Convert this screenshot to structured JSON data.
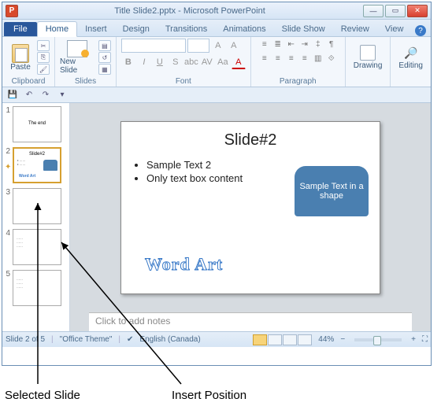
{
  "title": "Title Slide2.pptx - Microsoft PowerPoint",
  "app_icon_letter": "P",
  "tabs": {
    "file": "File",
    "home": "Home",
    "insert": "Insert",
    "design": "Design",
    "transitions": "Transitions",
    "animations": "Animations",
    "slideshow": "Slide Show",
    "review": "Review",
    "view": "View"
  },
  "ribbon": {
    "paste": "Paste",
    "clipboard": "Clipboard",
    "newslide": "New Slide",
    "slides": "Slides",
    "font": "Font",
    "paragraph": "Paragraph",
    "drawing": "Drawing",
    "editing": "Editing"
  },
  "thumbs": [
    "1",
    "2",
    "3",
    "4",
    "5"
  ],
  "thumb1_text": "The end",
  "thumb2_line1": "Slide#2",
  "thumb2_shape": "",
  "thumb2_wa": "Word Art",
  "slide": {
    "title": "Slide#2",
    "bullet1": "Sample Text 2",
    "bullet2": "Only text box content",
    "shape_text": "Sample Text in a shape",
    "wordart": "Word Art"
  },
  "notes_placeholder": "Click to add notes",
  "status": {
    "slide": "Slide 2 of 5",
    "theme": "\"Office Theme\"",
    "lang": "English (Canada)",
    "zoom": "44%"
  },
  "annotations": {
    "selected": "Selected Slide",
    "insert": "Insert Position"
  }
}
